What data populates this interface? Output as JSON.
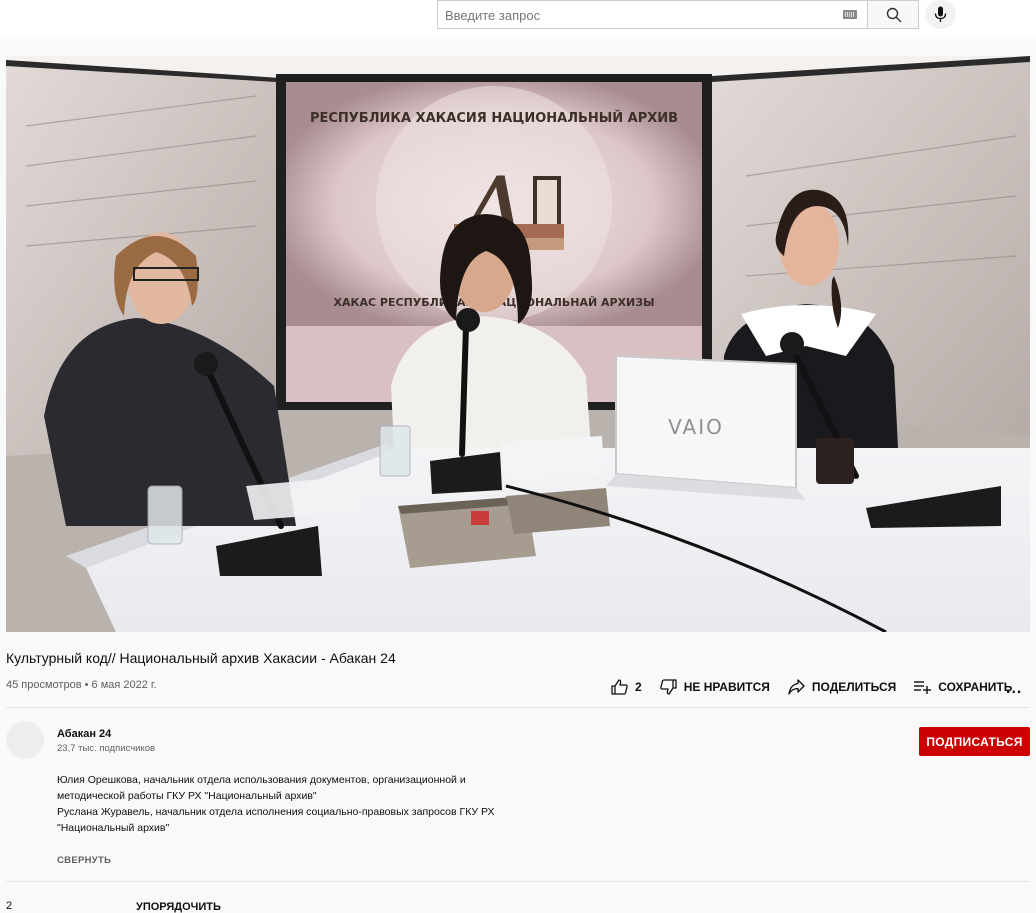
{
  "search": {
    "placeholder": "Введите запрос"
  },
  "video": {
    "title": "Культурный код// Национальный архив Хакасии - Абакан 24",
    "views": "45 просмотров",
    "separator": "•",
    "date": "6 мая 2022 г.",
    "backdrop_text_top": "РЕСПУБЛИКА ХАКАСИЯ НАЦИОНАЛЬНЫЙ АРХИВ",
    "backdrop_text_bottom": "ХАКАС РЕСПУБЛИКАЗЫ НАЦИОНАЛЬНАЙ АРХИЗЫ",
    "laptop_brand": "VAIO"
  },
  "actions": {
    "like_count": "2",
    "dislike_label": "НЕ НРАВИТСЯ",
    "share_label": "ПОДЕЛИТЬСЯ",
    "save_label": "СОХРАНИТЬ",
    "more_label": "..."
  },
  "channel": {
    "name": "Абакан 24",
    "subscribers": "23,7 тыс. подписчиков",
    "subscribe_label": "ПОДПИСАТЬСЯ"
  },
  "description": {
    "line1": "Юлия Орешкова, начальник отдела использования документов, организационной и методической работы ГКУ РХ \"Национальный архив\"",
    "line2": "Руслана Журавель, начальник отдела исполнения социально-правовых запросов ГКУ РХ \"Национальный архив\"",
    "collapse_label": "СВЕРНУТЬ"
  },
  "comments": {
    "count_cut": "2",
    "sort_label_cut": "УПОРЯДОЧИТЬ"
  },
  "colors": {
    "brand_red": "#cc0000",
    "text_secondary": "#606060"
  }
}
